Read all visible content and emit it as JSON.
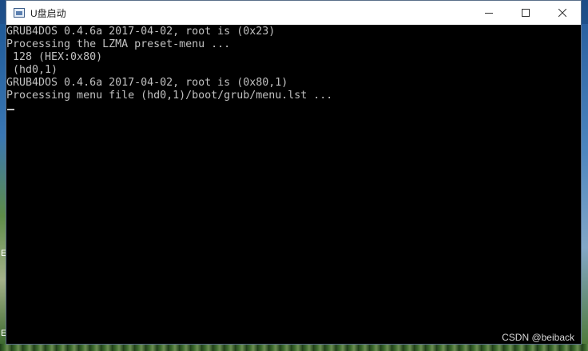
{
  "window": {
    "title": "U盘启动",
    "icon": "console-window-icon"
  },
  "controls": {
    "minimize_icon": "minimize-icon",
    "maximize_icon": "maximize-icon",
    "close_icon": "close-icon"
  },
  "console": {
    "lines": [
      "GRUB4DOS 0.4.6a 2017-04-02, root is (0x23)",
      "Processing the LZMA preset-menu ...",
      " 128 (HEX:0x80)",
      " (hd0,1)",
      "GRUB4DOS 0.4.6a 2017-04-02, root is (0x80,1)",
      "Processing menu file (hd0,1)/boot/grub/menu.lst ..."
    ],
    "foreground": "#c0c0c0",
    "background": "#000000"
  },
  "desktop": {
    "fragment_1": "E",
    "fragment_2": "E"
  },
  "watermark": "CSDN @beiback"
}
